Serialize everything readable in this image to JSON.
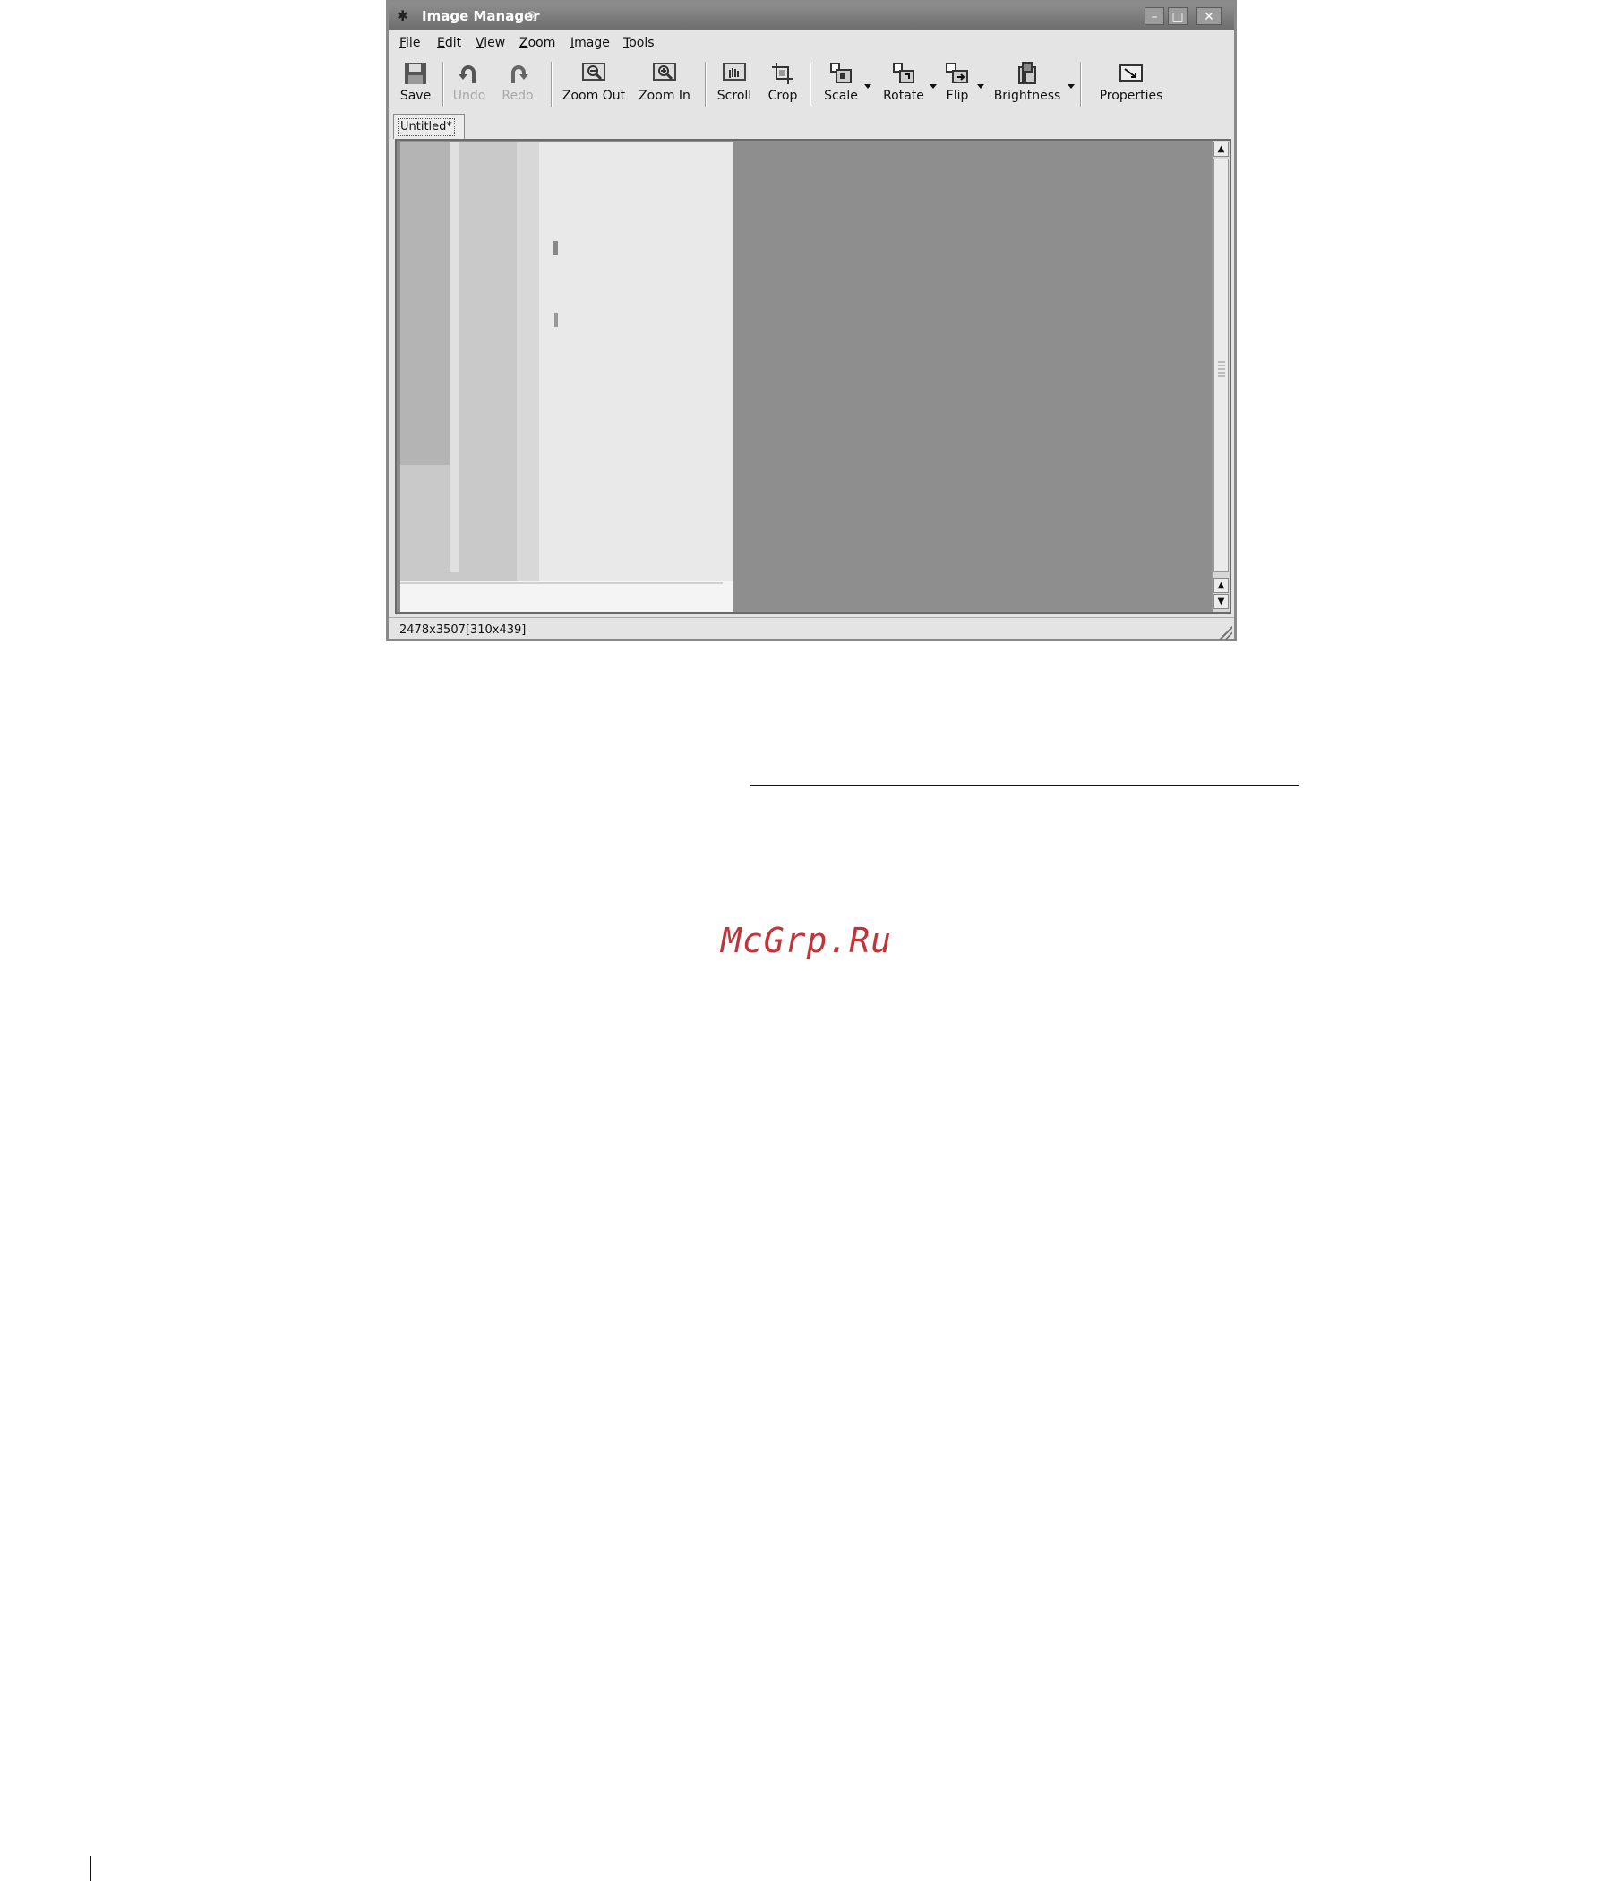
{
  "window": {
    "title": "Image Manager",
    "controls": {
      "minimize": "–",
      "maximize": "□",
      "close": "✕"
    }
  },
  "menu": [
    {
      "first": "F",
      "rest": "ile"
    },
    {
      "first": "E",
      "rest": "dit"
    },
    {
      "first": "V",
      "rest": "iew"
    },
    {
      "first": "Z",
      "rest": "oom"
    },
    {
      "first": "I",
      "rest": "mage"
    },
    {
      "first": "T",
      "rest": "ools"
    }
  ],
  "toolbar": {
    "save": "Save",
    "undo": "Undo",
    "redo": "Redo",
    "zoom_out": "Zoom Out",
    "zoom_in": "Zoom In",
    "scroll": "Scroll",
    "crop": "Crop",
    "scale": "Scale",
    "rotate": "Rotate",
    "flip": "Flip",
    "brightness": "Brightness",
    "properties": "Properties"
  },
  "tab": {
    "label": "Untitled*"
  },
  "status": {
    "text": "2478x3507[310x439]"
  },
  "page": {
    "watermark": "McGrp.Ru"
  },
  "colors": {
    "watermark": "#c0353a",
    "titlebar": "#7a7a7a",
    "canvas": "#8e8e8e"
  }
}
